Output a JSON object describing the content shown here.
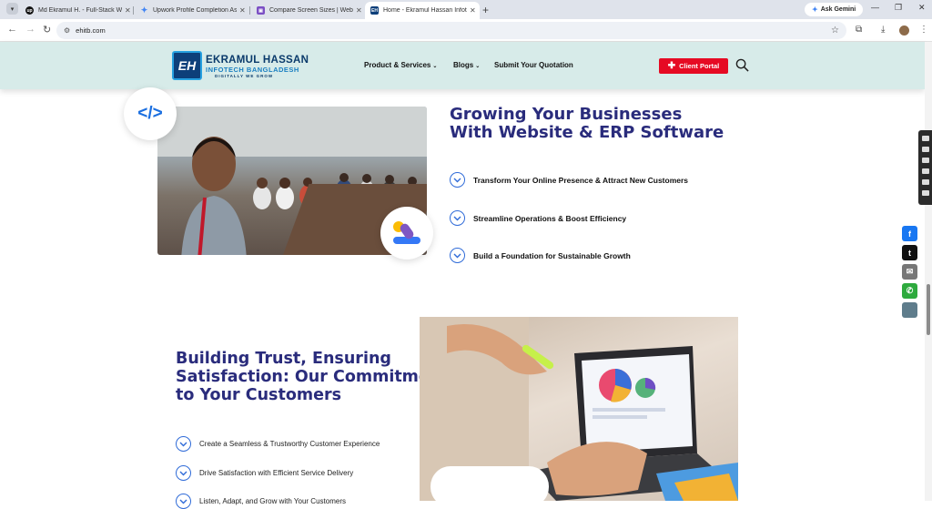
{
  "browser": {
    "tabs": [
      {
        "title": "Md Ekramul H. - Full-Stack Web",
        "favicon": "upwork"
      },
      {
        "title": "Upwork Profile Completion Ass",
        "favicon": "gemini"
      },
      {
        "title": "Compare Screen Sizes | Websit",
        "favicon": "compare"
      },
      {
        "title": "Home - Ekramul Hassan Infotec",
        "favicon": "eh"
      }
    ],
    "ask_gemini": "Ask Gemini",
    "url": "ehitb.com"
  },
  "site": {
    "logo": {
      "badge": "EH",
      "name": "EKRAMUL HASSAN",
      "sub": "INFOTECH BANGLADESH",
      "tagline": "DIGITALLY WE GROW"
    },
    "nav": [
      {
        "label": "Product & Services",
        "has_dropdown": true
      },
      {
        "label": "Blogs",
        "has_dropdown": true
      },
      {
        "label": "Submit Your Quotation",
        "has_dropdown": false
      }
    ],
    "client_portal": "Client Portal"
  },
  "section1": {
    "heading_line1": "Growing Your Businesses",
    "heading_line2": "With Website & ERP Software",
    "features": [
      "Transform Your Online Presence & Attract New Customers",
      "Streamline Operations & Boost Efficiency",
      "Build a Foundation for Sustainable Growth"
    ]
  },
  "section2": {
    "heading_line1": "Building Trust, Ensuring",
    "heading_line2": "Satisfaction: Our Commitment",
    "heading_line3": "to Your Customers",
    "features": [
      "Create a Seamless & Trustworthy Customer Experience",
      "Drive Satisfaction with Efficient Service Delivery",
      "Listen, Adapt, and Grow with Your Customers"
    ]
  },
  "social_icons": [
    {
      "name": "facebook-icon",
      "glyph": "f",
      "color": "#1877f2"
    },
    {
      "name": "twitter-icon",
      "glyph": "t",
      "color": "#111111"
    },
    {
      "name": "email-icon",
      "glyph": "✉",
      "color": "#777777"
    },
    {
      "name": "phone-icon",
      "glyph": "✆",
      "color": "#2eaa3e"
    },
    {
      "name": "share-icon",
      "glyph": "",
      "color": "#5f7d8c"
    }
  ],
  "colors": {
    "accent": "#2a2c7c",
    "brand_red": "#e60a23",
    "header_bg": "#d7ebe9",
    "check_blue": "#2f6bd8"
  }
}
